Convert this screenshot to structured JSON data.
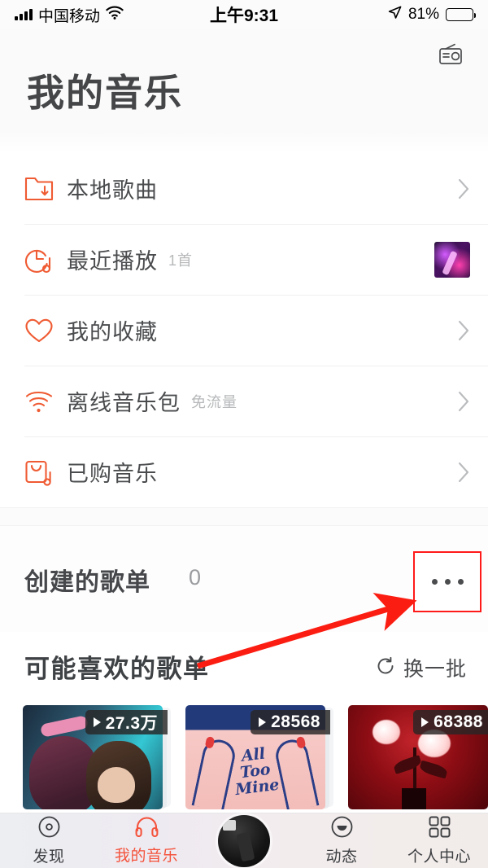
{
  "status_bar": {
    "carrier": "中国移动",
    "signal_icon": "signal-bars-icon",
    "wifi_icon": "wifi-icon",
    "time": "上午9:31",
    "location_icon": "location-arrow-icon",
    "battery_percent": "81%",
    "battery_icon": "battery-icon"
  },
  "header": {
    "title": "我的音乐",
    "radio_icon": "radio-icon"
  },
  "menu": {
    "items": [
      {
        "label": "本地歌曲",
        "sub": "",
        "icon": "folder-download-icon",
        "has_thumb": false,
        "chevron": "chevron-right-icon"
      },
      {
        "label": "最近播放",
        "sub": "1首",
        "icon": "clock-music-icon",
        "has_thumb": true,
        "chevron": ""
      },
      {
        "label": "我的收藏",
        "sub": "",
        "icon": "heart-icon",
        "has_thumb": false,
        "chevron": "chevron-right-icon"
      },
      {
        "label": "离线音乐包",
        "sub": "免流量",
        "icon": "wifi-offline-icon",
        "has_thumb": false,
        "chevron": "chevron-right-icon"
      },
      {
        "label": "已购音乐",
        "sub": "",
        "icon": "bag-music-icon",
        "has_thumb": false,
        "chevron": "chevron-right-icon"
      }
    ]
  },
  "created_playlists": {
    "title": "创建的歌单",
    "count": "0",
    "more_icon": "more-horizontal-icon"
  },
  "may_like": {
    "title": "可能喜欢的歌单",
    "refresh_label": "换一批",
    "refresh_icon": "refresh-icon",
    "cards": [
      {
        "play_count": "27.3万",
        "art": "anime-couple",
        "play_icon": "play-triangle-icon"
      },
      {
        "play_count": "28568",
        "art": "all-too-mine-hands",
        "script_line1": "All",
        "script_line2": "Too",
        "script_line3": "Mine",
        "play_icon": "play-triangle-icon"
      },
      {
        "play_count": "68388",
        "art": "red-roses",
        "play_icon": "play-triangle-icon"
      }
    ]
  },
  "annotation": {
    "highlight_color": "#ff1a1a",
    "arrow_color": "#fb1d11"
  },
  "tabbar": {
    "items": [
      {
        "label": "发现",
        "icon": "disc-circle-icon",
        "active": false
      },
      {
        "label": "我的音乐",
        "icon": "headphones-icon",
        "active": true
      },
      {
        "label": "",
        "icon": "now-playing-disc-icon",
        "active": false
      },
      {
        "label": "动态",
        "icon": "smiley-circle-icon",
        "active": false
      },
      {
        "label": "个人中心",
        "icon": "grid-squares-icon",
        "active": false
      }
    ],
    "active_color": "#f4533c"
  }
}
